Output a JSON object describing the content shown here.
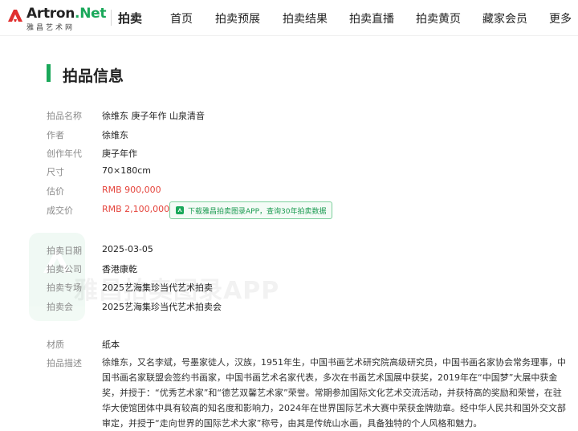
{
  "brand": {
    "name_part1": "Artron",
    "name_part2": ".Net",
    "subtitle": "雅昌艺术网",
    "section": "拍卖",
    "accent": "#1aa85a"
  },
  "nav": {
    "items": [
      "首页",
      "拍卖预展",
      "拍卖结果",
      "拍卖直播",
      "拍卖黄页",
      "藏家会员",
      "更多"
    ]
  },
  "page_title": "拍品信息",
  "watermark": "雅昌拍卖图录APP",
  "fields": {
    "name": {
      "label": "拍品名称",
      "value": "徐维东 庚子年作 山泉清音"
    },
    "author": {
      "label": "作者",
      "value": "徐维东"
    },
    "year": {
      "label": "创作年代",
      "value": "庚子年作"
    },
    "size": {
      "label": "尺寸",
      "value": "70×180cm"
    },
    "estimate": {
      "label": "估价",
      "value": "RMB 900,000"
    },
    "price": {
      "label": "成交价",
      "value": "RMB 2,100,000"
    },
    "date": {
      "label": "拍卖日期",
      "value": "2025-03-05"
    },
    "company": {
      "label": "拍卖公司",
      "value": "香港康乾"
    },
    "session": {
      "label": "拍卖专场",
      "value": "2025艺海集珍当代艺术拍卖"
    },
    "auction": {
      "label": "拍卖会",
      "value": "2025艺海集珍当代艺术拍卖会"
    },
    "material": {
      "label": "材质",
      "value": "纸本"
    },
    "description": {
      "label": "拍品描述",
      "value": "徐维东，又名李斌，号墨家徒人，汉族，1951年生，中国书画艺术研究院高级研究员，中国书画名家协会常务理事，中国书画名家联盟会签约书画家，中国书画艺术名家代表，多次在书画艺术国展中获奖，2019年在“中国梦”大展中获金奖，并授于：“优秀艺术家”和“德艺双馨艺术家”荣誉。常期参加国际文化艺术交流活动，并获特高的奖励和荣誉，在驻华大使馆团体中具有较高的知名度和影响力，2024年在世界国际艺术大赛中荣获金牌勋章。经中华人民共和国外交文部审定，并授于“走向世界的国际艺术大家”称号，由其是传统山水画，具备独特的个人风格和魅力。"
    }
  },
  "app_badge": "下载雅昌拍卖图录APP，查询30年拍卖数据",
  "colors": {
    "price_red": "#e5443c",
    "label_gray": "#8a8a8a"
  }
}
